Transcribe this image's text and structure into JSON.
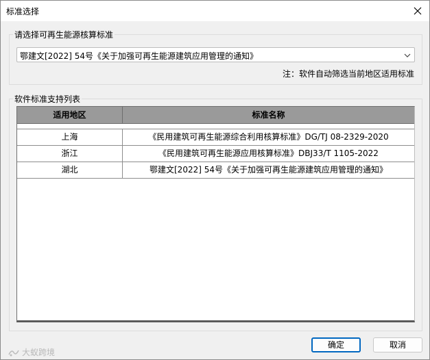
{
  "window": {
    "title": "标准选择"
  },
  "selection": {
    "group_label": "请选择可再生能源核算标准",
    "selected_value": "鄂建文[2022] 54号《关于加强可再生能源建筑应用管理的通知》",
    "note": "注：软件自动筛选当前地区适用标准"
  },
  "support_list": {
    "group_label": "软件标准支持列表",
    "columns": [
      "适用地区",
      "标准名称"
    ],
    "rows": [
      {
        "region": "上海",
        "standard": "《民用建筑可再生能源综合利用核算标准》DG/TJ 08-2329-2020"
      },
      {
        "region": "浙江",
        "standard": "《民用建筑可再生能源应用核算标准》DBJ33/T 1105-2022"
      },
      {
        "region": "湖北",
        "standard": "鄂建文[2022] 54号《关于加强可再生能源建筑应用管理的通知》"
      }
    ]
  },
  "buttons": {
    "ok": "确定",
    "cancel": "取消"
  },
  "watermark": {
    "text": "大蚁跨境"
  }
}
